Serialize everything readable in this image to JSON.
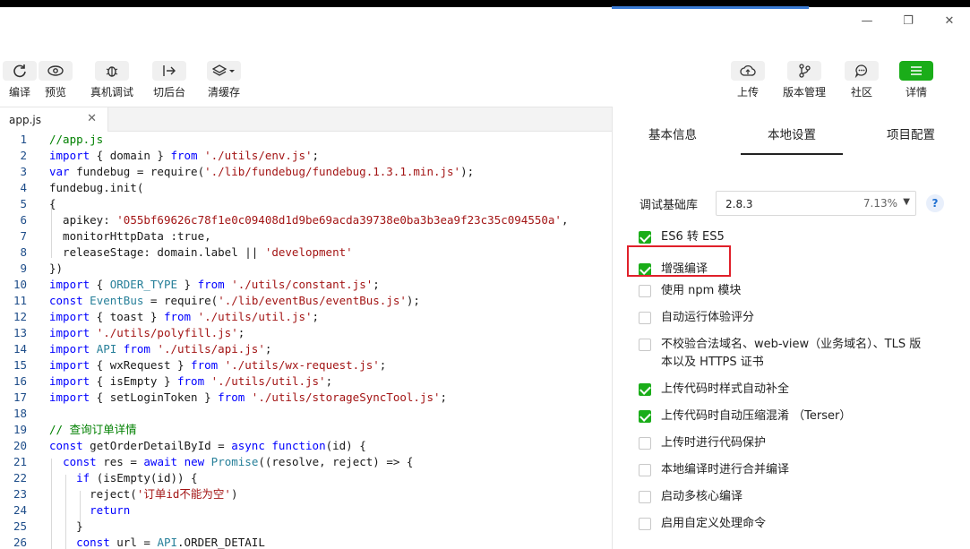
{
  "toolbar": {
    "compile": "编译",
    "preview": "预览",
    "device_debug": "真机调试",
    "background": "切后台",
    "clear_cache": "清缓存",
    "upload": "上传",
    "version": "版本管理",
    "community": "社区",
    "details": "详情"
  },
  "editor": {
    "file_tab": "app.js"
  },
  "panel": {
    "tabs": [
      "基本信息",
      "本地设置",
      "项目配置"
    ],
    "active_tab": "本地设置",
    "lib_label": "调试基础库",
    "lib_version": "2.8.3",
    "lib_percent": "7.13%",
    "help": "?",
    "options": [
      {
        "label": "ES6 转 ES5",
        "checked": true
      },
      {
        "label": "增强编译",
        "checked": true
      },
      {
        "label": "使用 npm 模块",
        "checked": false
      },
      {
        "label": "自动运行体验评分",
        "checked": false
      },
      {
        "label": "不校验合法域名、web-view（业务域名）、TLS 版",
        "label2": "本以及 HTTPS 证书",
        "checked": false
      },
      {
        "label": "上传代码时样式自动补全",
        "checked": true
      },
      {
        "label": "上传代码时自动压缩混淆 （Terser）",
        "checked": true
      },
      {
        "label": "上传时进行代码保护",
        "checked": false
      },
      {
        "label": "本地编译时进行合并编译",
        "checked": false
      },
      {
        "label": "启动多核心编译",
        "checked": false
      },
      {
        "label": "启用自定义处理命令",
        "checked": false
      }
    ]
  },
  "code_lines": [
    {
      "n": "1",
      "t": "//app.js"
    },
    {
      "n": "2",
      "t": "import { domain } from './utils/env.js';"
    },
    {
      "n": "3",
      "t": "var fundebug = require('./lib/fundebug/fundebug.1.3.1.min.js');"
    },
    {
      "n": "4",
      "t": "fundebug.init("
    },
    {
      "n": "5",
      "t": "{"
    },
    {
      "n": "6",
      "t": "  apikey: '055bf69626c78f1e0c09408d1d9be69acda39738e0ba3b3ea9f23c35c094550a',"
    },
    {
      "n": "7",
      "t": "  monitorHttpData :true,"
    },
    {
      "n": "8",
      "t": "  releaseStage: domain.label || 'development'"
    },
    {
      "n": "9",
      "t": "})"
    },
    {
      "n": "10",
      "t": "import { ORDER_TYPE } from './utils/constant.js';"
    },
    {
      "n": "11",
      "t": "const EventBus = require('./lib/eventBus/eventBus.js');"
    },
    {
      "n": "12",
      "t": "import { toast } from './utils/util.js';"
    },
    {
      "n": "13",
      "t": "import './utils/polyfill.js';"
    },
    {
      "n": "14",
      "t": "import API from './utils/api.js';"
    },
    {
      "n": "15",
      "t": "import { wxRequest } from './utils/wx-request.js';"
    },
    {
      "n": "16",
      "t": "import { isEmpty } from './utils/util.js';"
    },
    {
      "n": "17",
      "t": "import { setLoginToken } from './utils/storageSyncTool.js';"
    },
    {
      "n": "18",
      "t": ""
    },
    {
      "n": "19",
      "t": "// 查询订单详情"
    },
    {
      "n": "20",
      "t": "const getOrderDetailById = async function(id) {"
    },
    {
      "n": "21",
      "t": "  const res = await new Promise((resolve, reject) => {"
    },
    {
      "n": "22",
      "t": "    if (isEmpty(id)) {"
    },
    {
      "n": "23",
      "t": "      reject('订单id不能为空')"
    },
    {
      "n": "24",
      "t": "      return"
    },
    {
      "n": "25",
      "t": "    }"
    },
    {
      "n": "26",
      "t": "    const url = API.ORDER_DETAIL"
    }
  ]
}
